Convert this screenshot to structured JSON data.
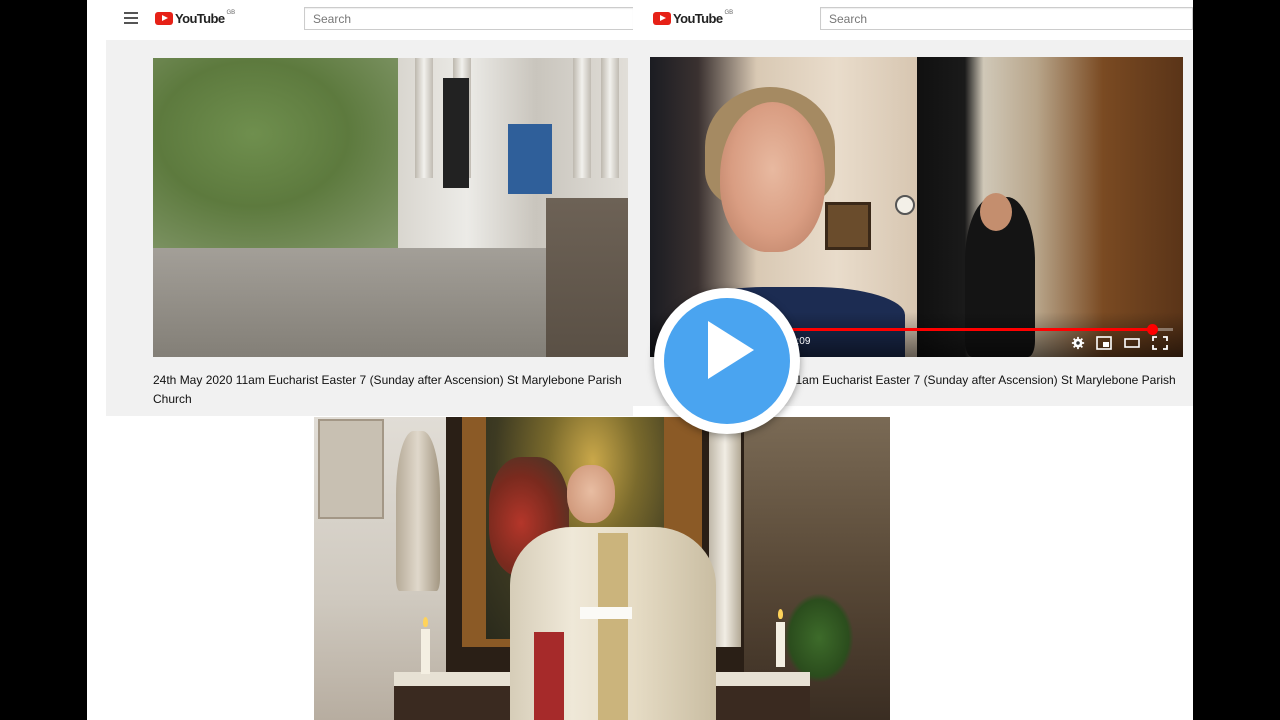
{
  "header_left": {
    "logo_text": "YouTube",
    "region": "GB",
    "search_placeholder": "Search"
  },
  "header_right": {
    "logo_text": "YouTube",
    "region": "GB",
    "search_placeholder": "Search"
  },
  "video_left": {
    "title": "24th May 2020 11am Eucharist Easter 7 (Sunday after Ascension) St Marylebone Parish Church"
  },
  "video_right": {
    "title": "24th May 2020 11am Eucharist Easter 7 (Sunday after Ascension) St Marylebone Parish Church",
    "player": {
      "time_readout": "27:51 / 29:09",
      "progress": 0.955
    }
  },
  "icons": {
    "menu": "hamburger-menu-icon",
    "volume": "volume-icon",
    "settings": "gear-icon",
    "miniplayer": "miniplayer-icon",
    "theater": "theater-mode-icon",
    "fullscreen": "fullscreen-icon",
    "play": "play-icon"
  },
  "colors": {
    "youtube_red": "#e62117",
    "progress_red": "#ff0000",
    "play_button_blue": "#4aa4f0"
  }
}
